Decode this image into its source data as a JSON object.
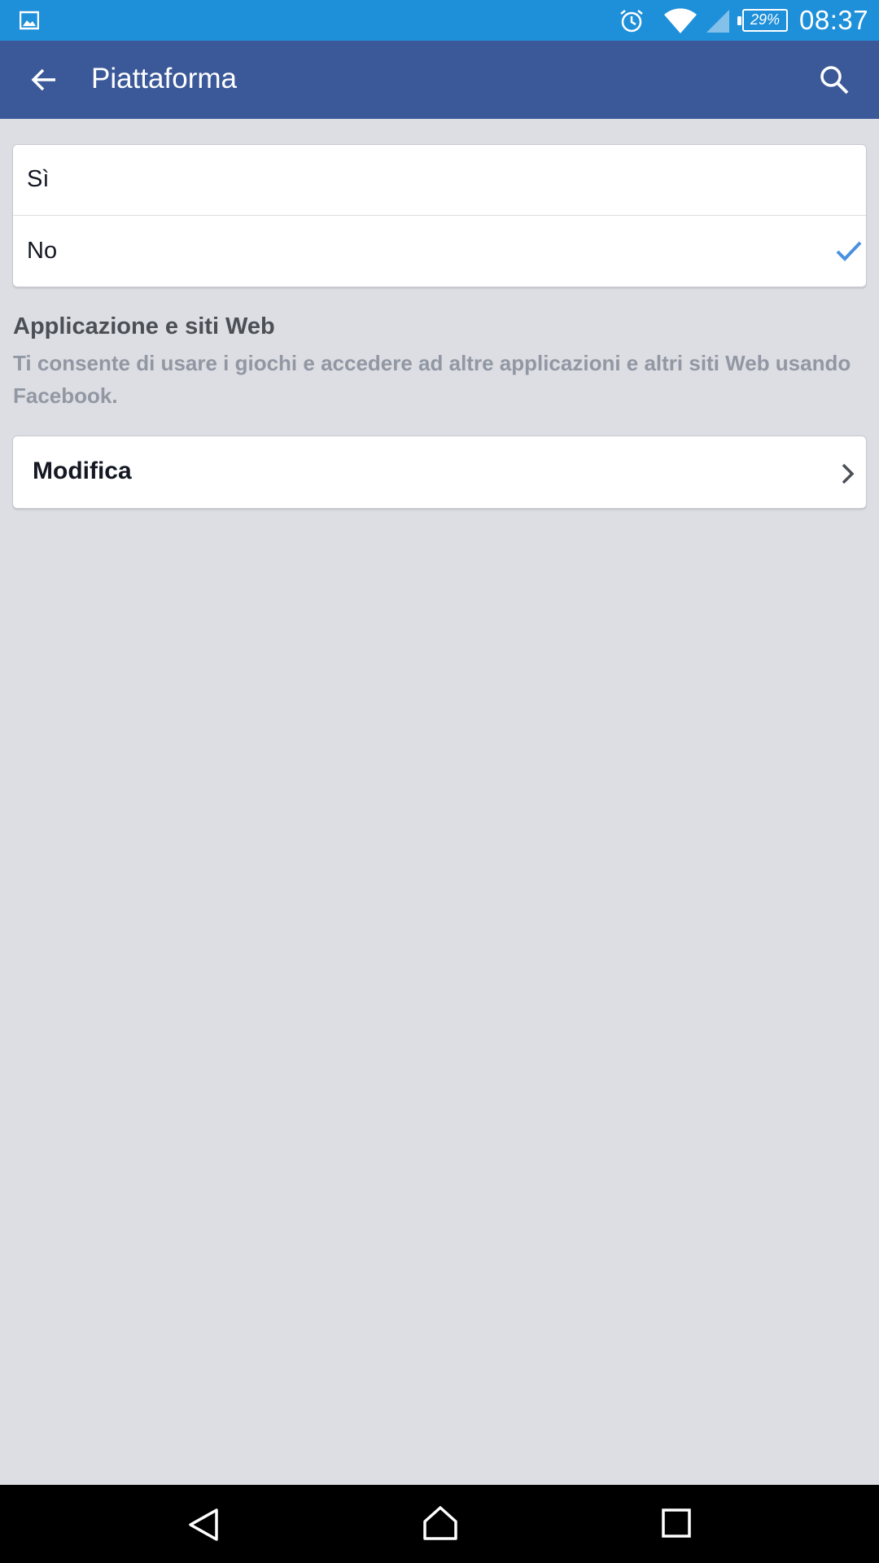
{
  "status_bar": {
    "battery_percent": "29%",
    "time": "08:37",
    "icons": [
      "gallery-icon",
      "alarm-icon",
      "wifi-icon",
      "signal-icon",
      "battery-icon"
    ]
  },
  "app_bar": {
    "title": "Piattaforma",
    "icons": [
      "back-arrow-icon",
      "search-icon"
    ]
  },
  "options": [
    {
      "label": "Sì",
      "selected": false
    },
    {
      "label": "No",
      "selected": true
    }
  ],
  "section": {
    "title": "Applicazione e siti Web",
    "description": "Ti consente di usare i giochi e accedere ad altre applicazioni e altri siti Web usando Facebook."
  },
  "edit_row": {
    "label": "Modifica"
  },
  "nav_bar": {
    "icons": [
      "nav-back-icon",
      "nav-home-icon",
      "nav-recents-icon"
    ]
  },
  "colors": {
    "status_bar": "#1e8fd9",
    "app_bar": "#3b5998",
    "background": "#dddee3",
    "check": "#4a90e2"
  }
}
